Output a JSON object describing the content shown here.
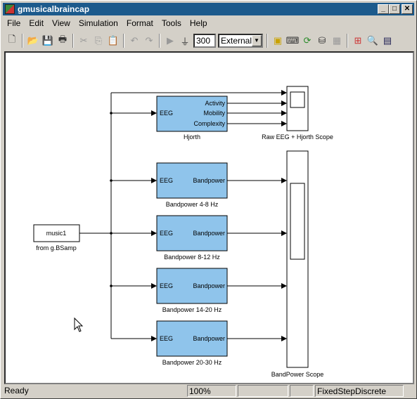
{
  "window": {
    "title": "gmusicalbraincap"
  },
  "menu": [
    "File",
    "Edit",
    "View",
    "Simulation",
    "Format",
    "Tools",
    "Help"
  ],
  "toolbar": {
    "stop_time": "300",
    "sim_mode": "External"
  },
  "diagram": {
    "source": {
      "value": "music1",
      "label": "from g.BSamp"
    },
    "hjorth": {
      "label": "Hjorth",
      "input": "EEG",
      "outputs": [
        "Activity",
        "Mobility",
        "Complexity"
      ]
    },
    "bandpower_blocks": [
      {
        "label": "Bandpower 4-8 Hz",
        "input": "EEG",
        "output": "Bandpower"
      },
      {
        "label": "Bandpower 8-12 Hz",
        "input": "EEG",
        "output": "Bandpower"
      },
      {
        "label": "Bandpower 14-20 Hz",
        "input": "EEG",
        "output": "Bandpower"
      },
      {
        "label": "Bandpower 20-30 Hz",
        "input": "EEG",
        "output": "Bandpower"
      }
    ],
    "raw_scope": {
      "label": "Raw EEG + Hjorth Scope"
    },
    "band_scope": {
      "label": "BandPower Scope"
    },
    "block_color": "#8fc4eb"
  },
  "status": {
    "text": "Ready",
    "zoom": "100%",
    "solver": "FixedStepDiscrete"
  }
}
